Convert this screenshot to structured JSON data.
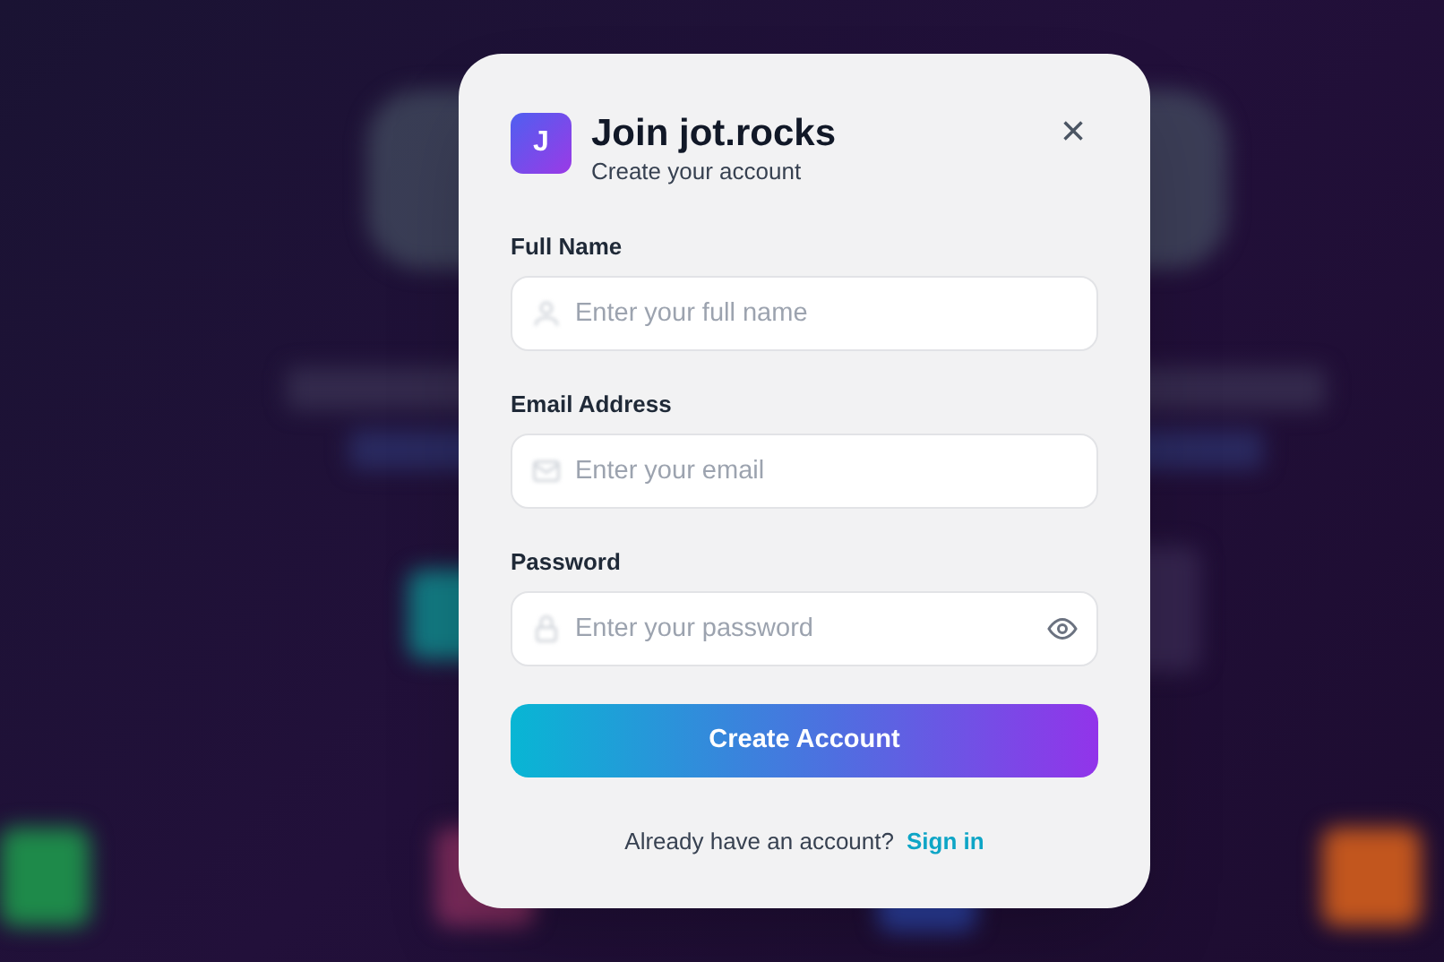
{
  "dialog": {
    "logo_letter": "J",
    "title": "Join jot.rocks",
    "subtitle": "Create your account",
    "close_symbol": "×"
  },
  "fields": [
    {
      "kind": "name",
      "label": "Full Name",
      "placeholder": "Enter your full name",
      "reveal_toggle": false
    },
    {
      "kind": "email",
      "label": "Email Address",
      "placeholder": "Enter your email",
      "reveal_toggle": false
    },
    {
      "kind": "password",
      "label": "Password",
      "placeholder": "Enter your password",
      "reveal_toggle": true
    }
  ],
  "submit": "Create Account",
  "footer": {
    "prompt": "Already have an account?",
    "link": "Sign in"
  }
}
